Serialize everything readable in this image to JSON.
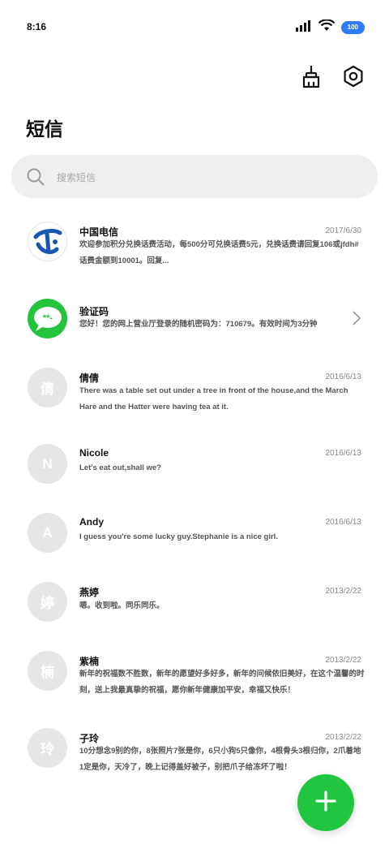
{
  "status_bar": {
    "time": "8:16",
    "battery": "100"
  },
  "toolbar": {
    "clean_icon": "broom-icon",
    "settings_icon": "settings-icon"
  },
  "page": {
    "title": "短信"
  },
  "search": {
    "placeholder": "搜索短信"
  },
  "messages": [
    {
      "sender": "中国电信",
      "date": "2017/6/30",
      "preview": "欢迎参加积分兑换话费活动，每500分可兑换话费5元，兑换话费请回复106或jfdh#话费金额到10001。回复...",
      "avatar": "telecom-logo"
    },
    {
      "sender": "验证码",
      "date": "",
      "preview": "您好！您的网上营业厅登录的随机密码为：710679。有效时间为3分钟",
      "avatar_text": "**-"
    },
    {
      "sender": "倩倩",
      "date": "2016/6/13",
      "preview": "There was a table set out under a tree in front of the house,and the March Hare and the Hatter were having tea at it.",
      "avatar_text": "倩"
    },
    {
      "sender": "Nicole",
      "date": "2016/6/13",
      "preview": "Let's eat out,shall we?",
      "avatar_text": "N"
    },
    {
      "sender": "Andy",
      "date": "2016/6/13",
      "preview": "I guess you're some lucky guy.Stephanie is a nice girl.",
      "avatar_text": "A"
    },
    {
      "sender": "燕婷",
      "date": "2013/2/22",
      "preview": "嗯。收到啦。同乐同乐。",
      "avatar_text": "婷"
    },
    {
      "sender": "紫楠",
      "date": "2013/2/22",
      "preview": "新年的祝福数不胜数，新年的愿望好多好多，新年的问候依旧美好，在这个温馨的时刻，送上我最真挚的祝福，愿你新年健康加平安，幸福又快乐！",
      "avatar_text": "楠"
    },
    {
      "sender": "子玲",
      "date": "2013/2/22",
      "preview": "10分想念9别的你，8张照片7张是你，6只小狗5只像你，4根骨头3根归你，2爪着地1定是你，天冷了，晚上记得盖好被子，别把爪子给冻坏了啦！",
      "avatar_text": "玲"
    }
  ],
  "fab": {
    "icon": "plus-icon"
  },
  "colors": {
    "accent_green": "#22c53f",
    "battery_blue": "#2f7bf5",
    "avatar_gray": "#e6e6e6"
  }
}
